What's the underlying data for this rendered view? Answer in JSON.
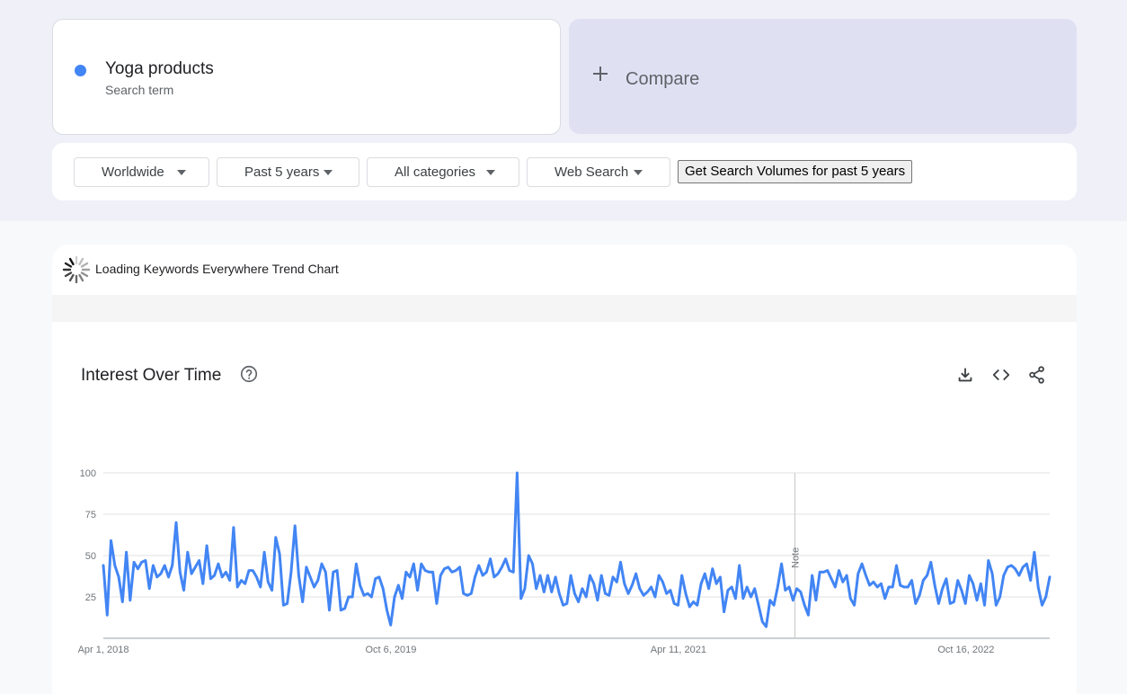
{
  "search": {
    "term": "Yoga products",
    "term_sub": "Search term",
    "compare_label": "Compare",
    "term_color": "#4285f4"
  },
  "filters": {
    "region": "Worldwide",
    "time_range": "Past 5 years",
    "category": "All categories",
    "property": "Web Search",
    "volume_button": "Get Search Volumes for past 5 years"
  },
  "extension": {
    "loading_text": "Loading Keywords Everywhere Trend Chart"
  },
  "panel": {
    "title": "Interest Over Time",
    "icons": [
      "help-icon",
      "download-icon",
      "embed-icon",
      "share-icon"
    ]
  },
  "chart_data": {
    "type": "line",
    "title": "",
    "xlabel": "",
    "ylabel": "",
    "x_start": "2018-04-01",
    "x_end": "2023-03-26",
    "ylim": [
      0,
      100
    ],
    "yticks": [
      25,
      50,
      75,
      100
    ],
    "xtick_labels": [
      "Apr 1, 2018",
      "Oct 6, 2019",
      "Apr 11, 2021",
      "Oct 16, 2022"
    ],
    "xtick_dates": [
      "2018-04-01",
      "2019-10-06",
      "2021-04-11",
      "2022-10-16"
    ],
    "annotation": {
      "date": "2021-11-21",
      "label": "Note"
    },
    "line_color": "#4285f4",
    "grid": true,
    "series": [
      {
        "values": [
          44,
          14,
          59,
          44,
          37,
          22,
          52,
          23,
          46,
          42,
          46,
          47,
          30,
          44,
          37,
          39,
          44,
          37,
          44,
          70,
          40,
          29,
          52,
          39,
          43,
          47,
          33,
          56,
          36,
          38,
          45,
          37,
          40,
          35,
          67,
          31,
          35,
          33,
          41,
          41,
          37,
          31,
          52,
          34,
          29,
          61,
          51,
          20,
          21,
          40,
          68,
          38,
          22,
          43,
          37,
          31,
          35,
          45,
          40,
          17,
          40,
          41,
          17,
          18,
          25,
          25,
          45,
          32,
          26,
          27,
          25,
          36,
          37,
          30,
          17,
          8,
          25,
          32,
          24,
          40,
          37,
          45,
          29,
          45,
          41,
          40,
          40,
          21,
          38,
          42,
          43,
          40,
          41,
          43,
          27,
          26,
          27,
          37,
          44,
          38,
          40,
          48,
          37,
          39,
          43,
          48,
          41,
          40,
          100,
          24,
          30,
          50,
          45,
          30,
          38,
          28,
          38,
          28,
          37,
          27,
          20,
          21,
          38,
          27,
          22,
          30,
          25,
          38,
          33,
          23,
          38,
          27,
          26,
          37,
          34,
          46,
          33,
          27,
          32,
          39,
          30,
          26,
          28,
          31,
          25,
          38,
          34,
          27,
          29,
          21,
          20,
          38,
          27,
          19,
          22,
          20,
          33,
          39,
          30,
          42,
          33,
          37,
          16,
          29,
          31,
          24,
          44,
          24,
          31,
          25,
          30,
          20,
          10,
          7,
          23,
          20,
          31,
          45,
          29,
          31,
          23,
          30,
          28,
          20,
          14,
          38,
          23,
          40,
          40,
          41,
          36,
          31,
          41,
          34,
          38,
          24,
          20,
          39,
          45,
          38,
          32,
          34,
          31,
          33,
          24,
          31,
          31,
          44,
          32,
          31,
          31,
          35,
          21,
          26,
          35,
          38,
          46,
          32,
          21,
          30,
          36,
          21,
          22,
          35,
          29,
          21,
          38,
          33,
          23,
          33,
          20,
          47,
          39,
          20,
          25,
          38,
          43,
          44,
          42,
          38,
          43,
          45,
          35,
          52,
          31,
          20,
          25,
          37
        ]
      }
    ]
  }
}
